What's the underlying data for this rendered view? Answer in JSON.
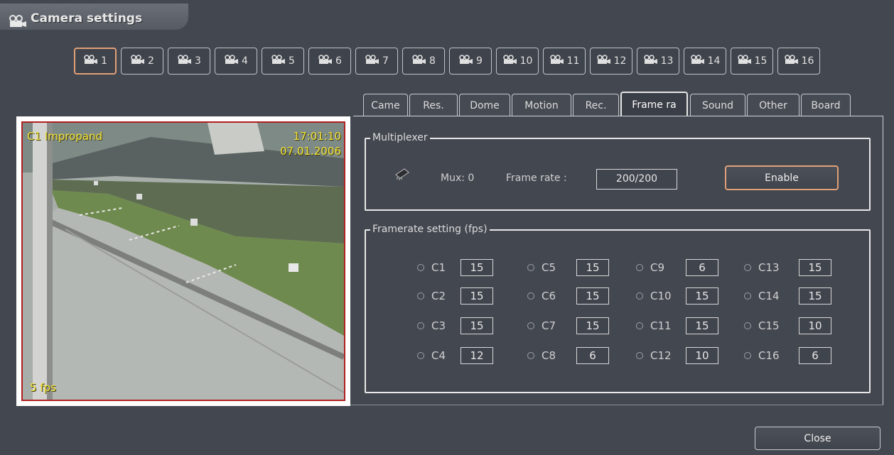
{
  "window": {
    "title": "Camera settings"
  },
  "cameras": [
    "1",
    "2",
    "3",
    "4",
    "5",
    "6",
    "7",
    "8",
    "9",
    "10",
    "11",
    "12",
    "13",
    "14",
    "15",
    "16"
  ],
  "tabs": [
    "Came",
    "Res.",
    "Dome",
    "Motion",
    "Rec.",
    "Frame ra",
    "Sound",
    "Other",
    "Board"
  ],
  "active_tab": "Frame ra",
  "active_camera": "1",
  "video": {
    "camera_name": "C1 Impropand",
    "time": "17:01:10",
    "date": "07.01.2006",
    "fps": "5 fps"
  },
  "multiplexer": {
    "label": "Multiplexer",
    "mux": "Mux: 0",
    "frame_rate_label": "Frame rate :",
    "frame_rate_value": "200/200",
    "enable_label": "Enable"
  },
  "framerate": {
    "label": "Framerate setting (fps)",
    "channels": [
      {
        "name": "C1",
        "value": "15"
      },
      {
        "name": "C2",
        "value": "15"
      },
      {
        "name": "C3",
        "value": "15"
      },
      {
        "name": "C4",
        "value": "12"
      },
      {
        "name": "C5",
        "value": "15"
      },
      {
        "name": "C6",
        "value": "15"
      },
      {
        "name": "C7",
        "value": "15"
      },
      {
        "name": "C8",
        "value": "6"
      },
      {
        "name": "C9",
        "value": "6"
      },
      {
        "name": "C10",
        "value": "15"
      },
      {
        "name": "C11",
        "value": "15"
      },
      {
        "name": "C12",
        "value": "10"
      },
      {
        "name": "C13",
        "value": "15"
      },
      {
        "name": "C14",
        "value": "15"
      },
      {
        "name": "C15",
        "value": "10"
      },
      {
        "name": "C16",
        "value": "6"
      }
    ]
  },
  "close_label": "Close",
  "colors": {
    "accent": "#e0a078",
    "background": "#434750",
    "osd_text": "#f3e23a",
    "video_border": "#b02020"
  }
}
